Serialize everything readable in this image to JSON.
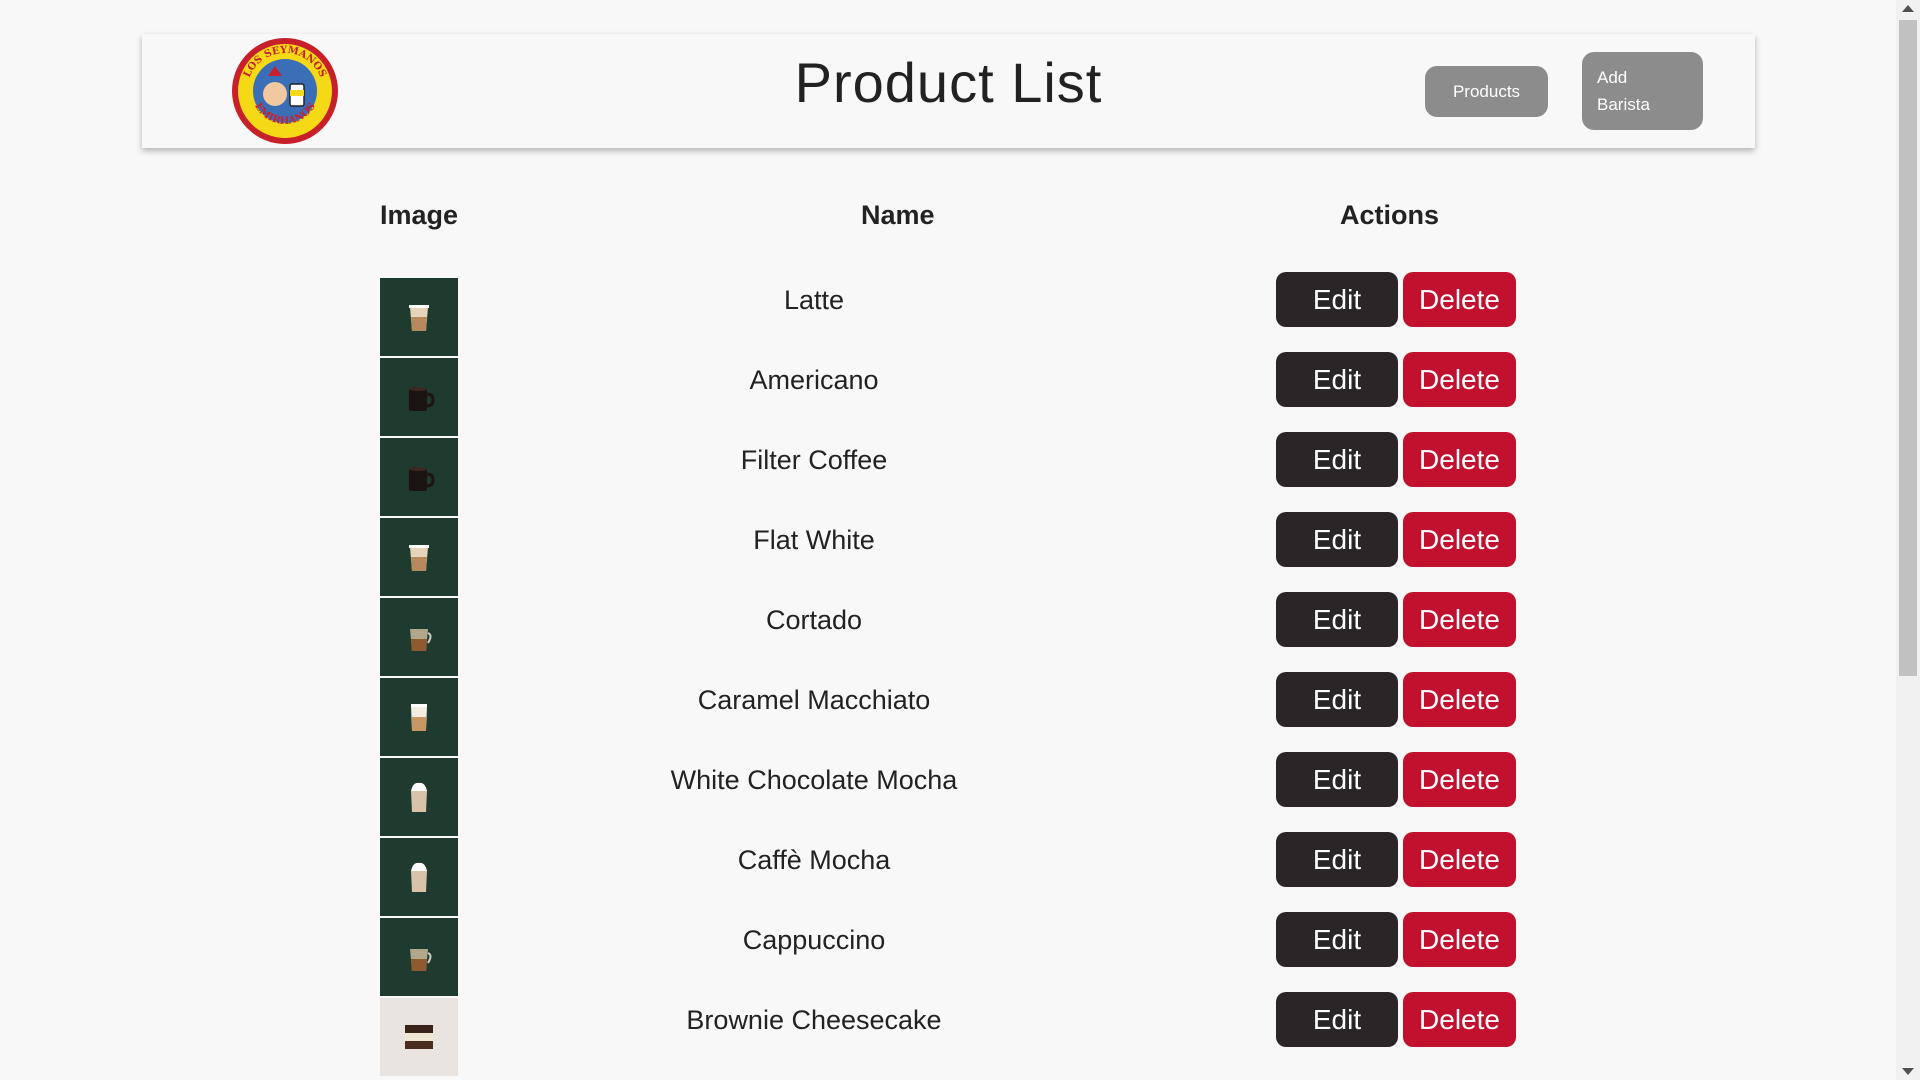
{
  "header": {
    "title": "Product List",
    "logo_text_top": "LOS SEYMANOS",
    "logo_text_bottom": "EMIRHANOS",
    "nav": {
      "products_label": "Products",
      "add_barista_line1": "Add",
      "add_barista_line2": "Barista"
    }
  },
  "table": {
    "columns": [
      "Image",
      "Name",
      "Actions"
    ],
    "edit_label": "Edit",
    "delete_label": "Delete",
    "rows": [
      {
        "name": "Latte",
        "image": "latte-cup"
      },
      {
        "name": "Americano",
        "image": "black-coffee-mug"
      },
      {
        "name": "Filter Coffee",
        "image": "black-coffee-mug"
      },
      {
        "name": "Flat White",
        "image": "latte-cup"
      },
      {
        "name": "Cortado",
        "image": "glass-coffee"
      },
      {
        "name": "Caramel Macchiato",
        "image": "layered-cup"
      },
      {
        "name": "White Chocolate Mocha",
        "image": "whipped-cream-cup"
      },
      {
        "name": "Caffè Mocha",
        "image": "whipped-cream-cup"
      },
      {
        "name": "Cappuccino",
        "image": "glass-coffee"
      },
      {
        "name": "Brownie Cheesecake",
        "image": "brownie-cheesecake"
      }
    ]
  },
  "colors": {
    "edit": "#2a2628",
    "delete": "#c2102f",
    "nav_button": "#8c8c8c",
    "thumb_bg": "#1f3b30",
    "background": "#f8f8f8"
  }
}
